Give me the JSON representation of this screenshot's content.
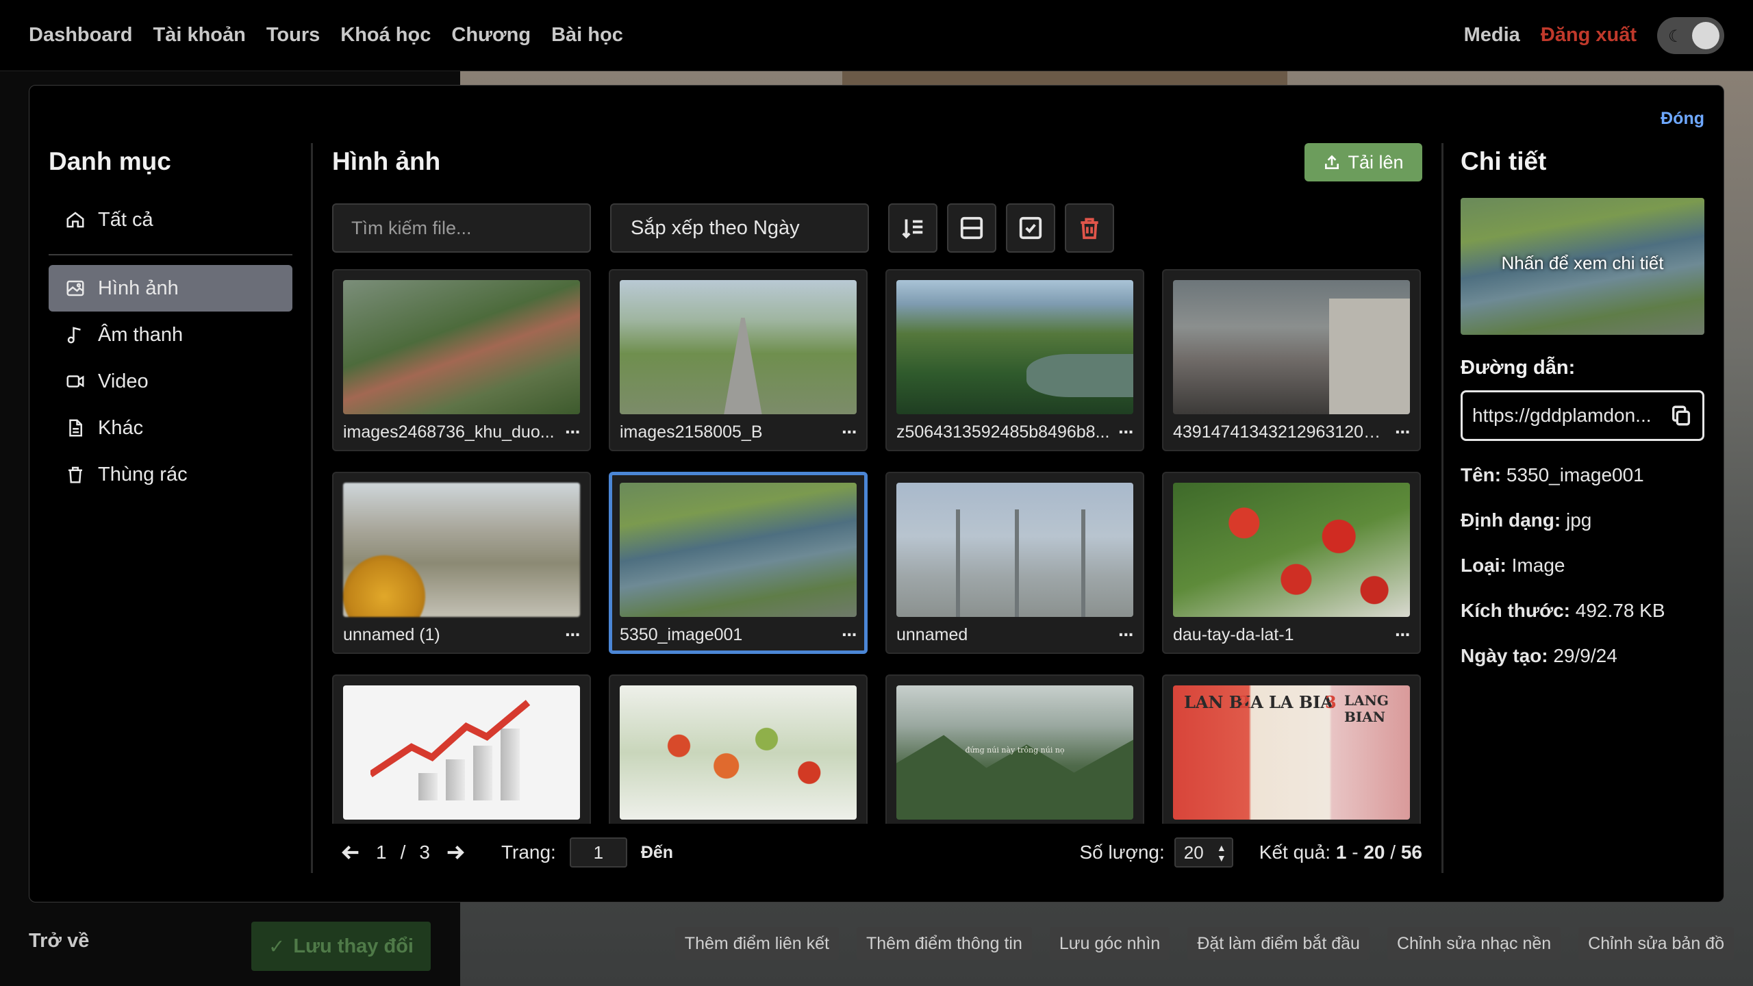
{
  "nav": {
    "links": [
      "Dashboard",
      "Tài khoản",
      "Tours",
      "Khoá học",
      "Chương",
      "Bài học"
    ],
    "media": "Media",
    "logout": "Đăng xuất"
  },
  "modal": {
    "close": "Đóng",
    "categories": {
      "title": "Danh mục",
      "items": [
        {
          "label": "Tất cả",
          "icon": "home-icon"
        },
        {
          "label": "Hình ảnh",
          "icon": "image-icon",
          "active": true
        },
        {
          "label": "Âm thanh",
          "icon": "music-icon"
        },
        {
          "label": "Video",
          "icon": "video-icon"
        },
        {
          "label": "Khác",
          "icon": "file-icon"
        },
        {
          "label": "Thùng rác",
          "icon": "trash-icon"
        }
      ]
    },
    "center": {
      "title": "Hình ảnh",
      "upload": "Tải lên",
      "search_placeholder": "Tìm kiếm file...",
      "sort": "Sắp xếp theo Ngày",
      "files": [
        {
          "name": "images2468736_khu_duo..."
        },
        {
          "name": "images2158005_B"
        },
        {
          "name": "z5064313592485b8496b8..."
        },
        {
          "name": "4391474134321296312​01..."
        },
        {
          "name": "unnamed (1)"
        },
        {
          "name": "5350_image001",
          "selected": true
        },
        {
          "name": "unnamed"
        },
        {
          "name": "dau-tay-da-lat-1"
        },
        {
          "name": ""
        },
        {
          "name": ""
        },
        {
          "name": ""
        },
        {
          "name": ""
        }
      ],
      "thumb_caption": "đứng núi này trông núi nọ",
      "book_titles": [
        "LAN BIA",
        "LA BIA",
        "LANG BIAN"
      ],
      "book_numbers": [
        "2",
        "3"
      ],
      "pager": {
        "current": "1",
        "separator": "/",
        "total": "3",
        "page_label": "Trang:",
        "page_value": "1",
        "goto": "Đến",
        "qty_label": "Số lượng:",
        "qty_value": "20",
        "result_label": "Kết quả:",
        "result_from": "1",
        "result_dash": "-",
        "result_to": "20",
        "result_sep": "/",
        "result_total": "56"
      }
    },
    "detail": {
      "title": "Chi tiết",
      "preview_label": "Nhấn để xem chi tiết",
      "url_label": "Đường dẫn:",
      "url_value": "https://gddplamdon...",
      "name_key": "Tên:",
      "name_value": "5350_image001",
      "format_key": "Định dạng:",
      "format_value": "jpg",
      "type_key": "Loại:",
      "type_value": "Image",
      "size_key": "Kích thước:",
      "size_value": "492.78 KB",
      "date_key": "Ngày tạo:",
      "date_value": "29/9/24"
    }
  },
  "bottom": {
    "back": "Trở về",
    "save": "Lưu thay đổi",
    "actions": [
      "Thêm điểm liên kết",
      "Thêm điểm thông tin",
      "Lưu góc nhìn",
      "Đặt làm điểm bắt đầu",
      "Chỉnh sửa nhạc nền",
      "Chỉnh sửa bản đồ"
    ]
  },
  "colors": {
    "accent": "#4b86d6",
    "upload": "#6c9d5c",
    "logout": "#c0392b",
    "close": "#6ea8ff",
    "danger": "#e0554a"
  }
}
